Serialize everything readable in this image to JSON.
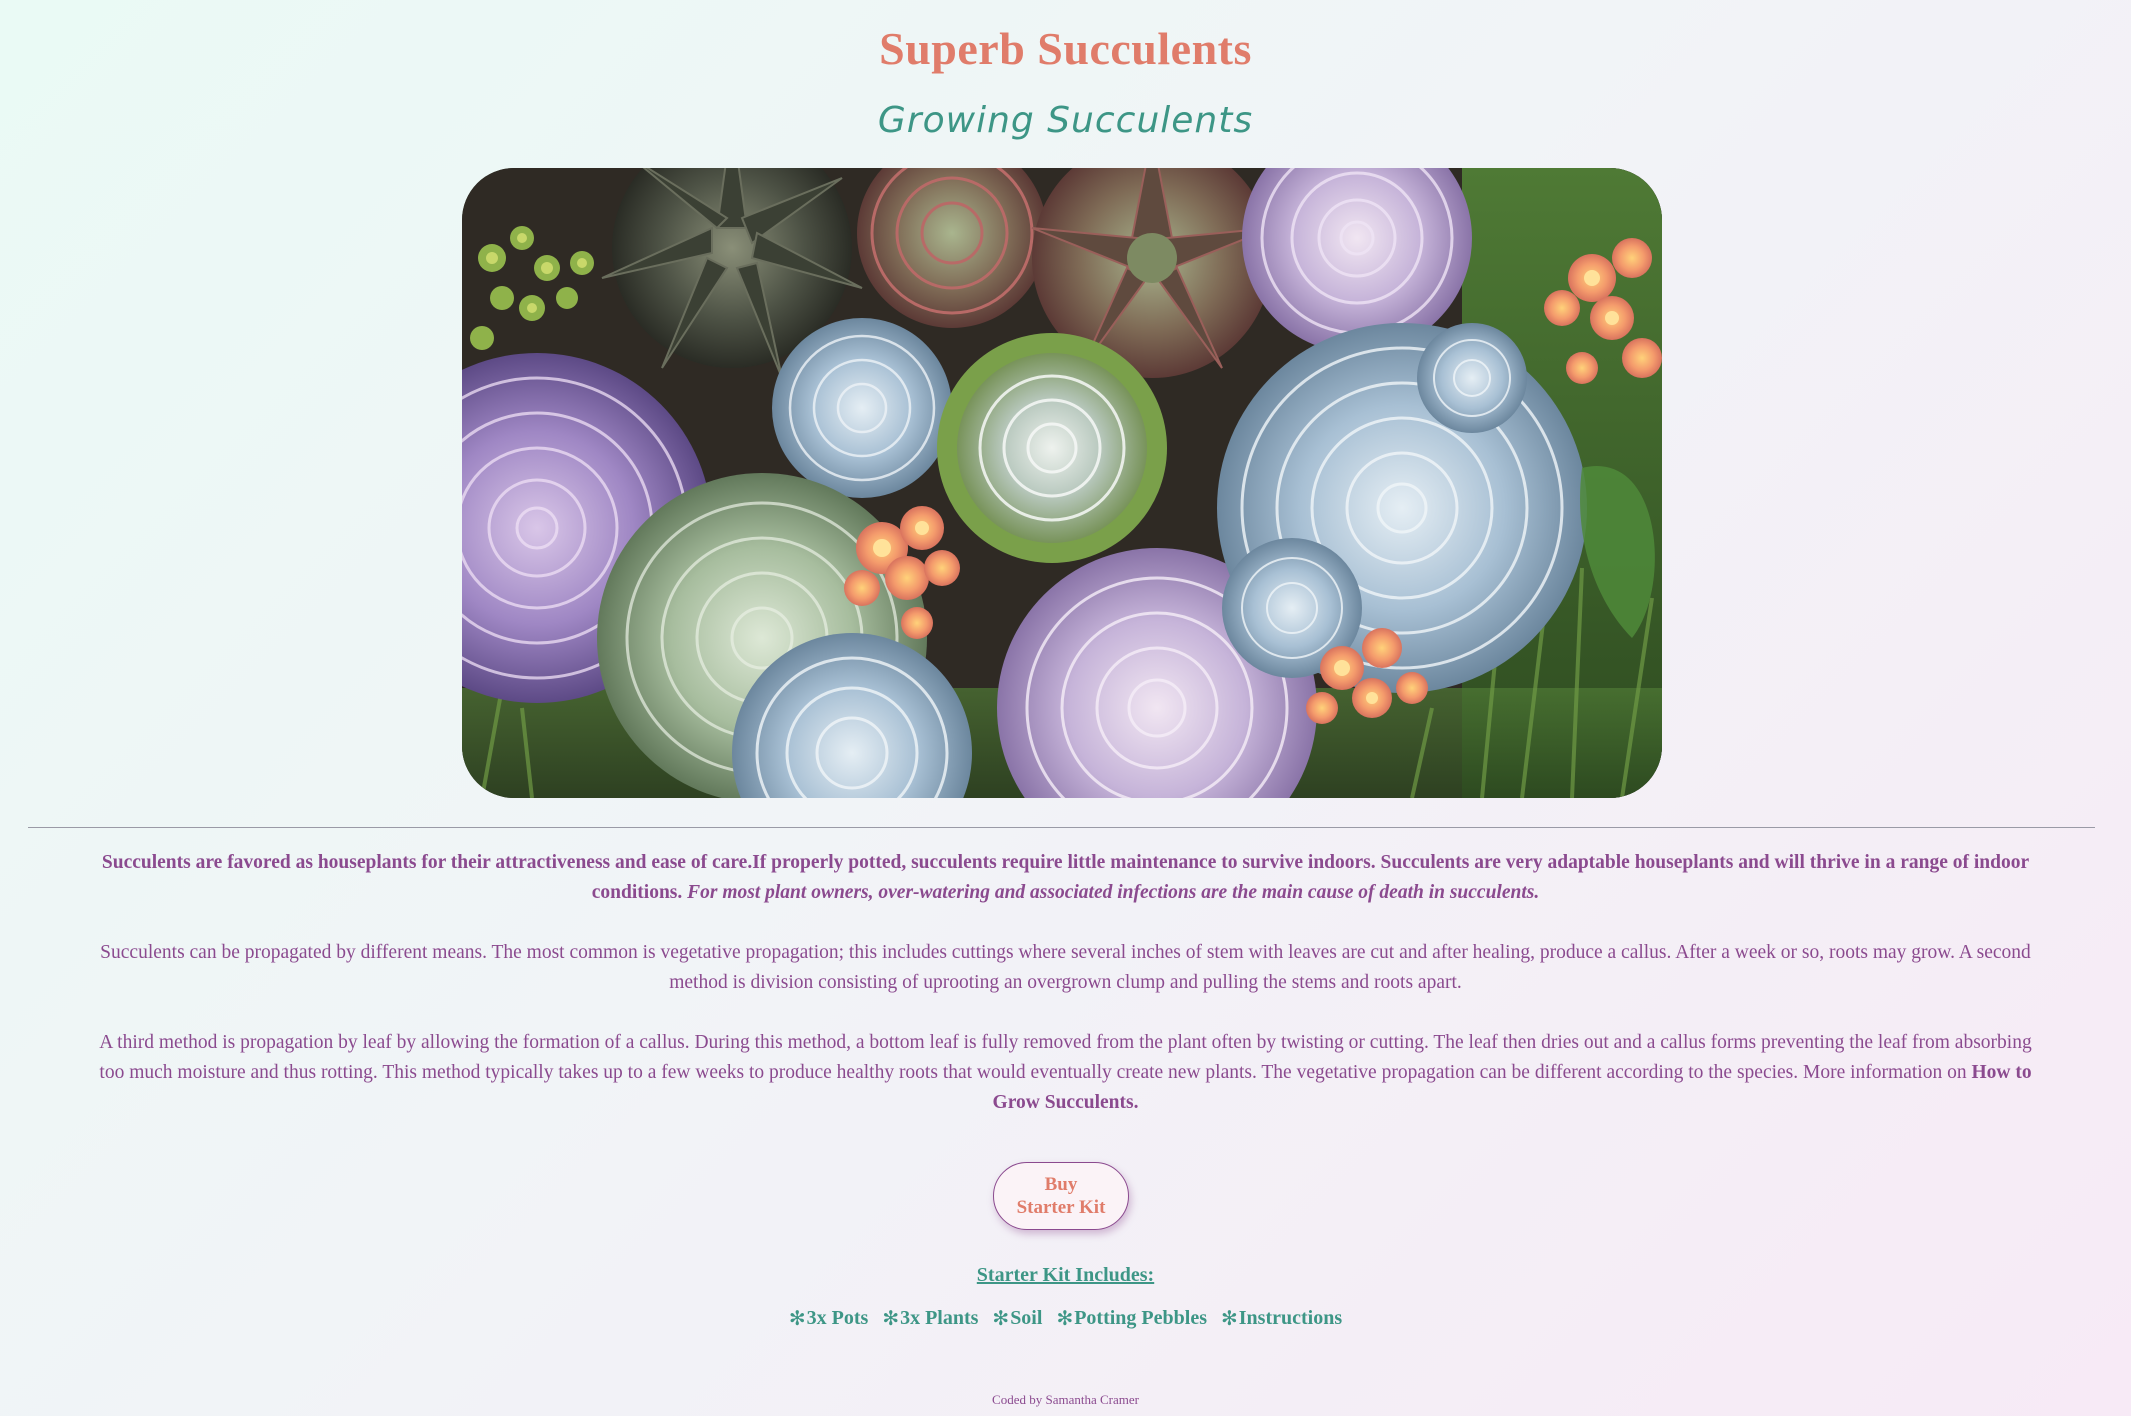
{
  "header": {
    "title": "Superb Succulents",
    "subtitle": "Growing Succulents"
  },
  "hero": {
    "image_subject": "succulent-arrangement-photo"
  },
  "content": {
    "lead_bold": "Succulents are favored as houseplants for their attractiveness and ease of care.If properly potted, succulents require little maintenance to survive indoors. Succulents are very adaptable houseplants and will thrive in a range of indoor conditions. ",
    "lead_italic": "For most plant owners, over-watering and associated infections are the main cause of death in succulents.",
    "paragraph_2": "Succulents can be propagated by different means. The most common is vegetative propagation; this includes cuttings where several inches of stem with leaves are cut and after healing, produce a callus. After a week or so, roots may grow. A second method is division consisting of uprooting an overgrown clump and pulling the stems and roots apart.",
    "paragraph_3": "A third method is propagation by leaf by allowing the formation of a callus. During this method, a bottom leaf is fully removed from the plant often by twisting or cutting. The leaf then dries out and a callus forms preventing the leaf from absorbing too much moisture and thus rotting. This method typically takes up to a few weeks to produce healthy roots that would eventually create new plants. The vegetative propagation can be different according to the species. More information on ",
    "more_info_link": "How to Grow Succulents."
  },
  "buy_button": {
    "line1": "Buy",
    "line2": "Starter Kit"
  },
  "kit": {
    "heading": "Starter Kit Includes:",
    "bullet_glyph": "✻",
    "items": [
      "3x Pots",
      "3x Plants",
      "Soil",
      "Potting Pebbles",
      "Instructions"
    ]
  },
  "footer": {
    "credit": "Coded by Samantha Cramer"
  },
  "colors": {
    "title": "#e07c6a",
    "subtitle": "#3d9686",
    "text": "#8b4a8f",
    "accent_teal": "#3d9686"
  }
}
